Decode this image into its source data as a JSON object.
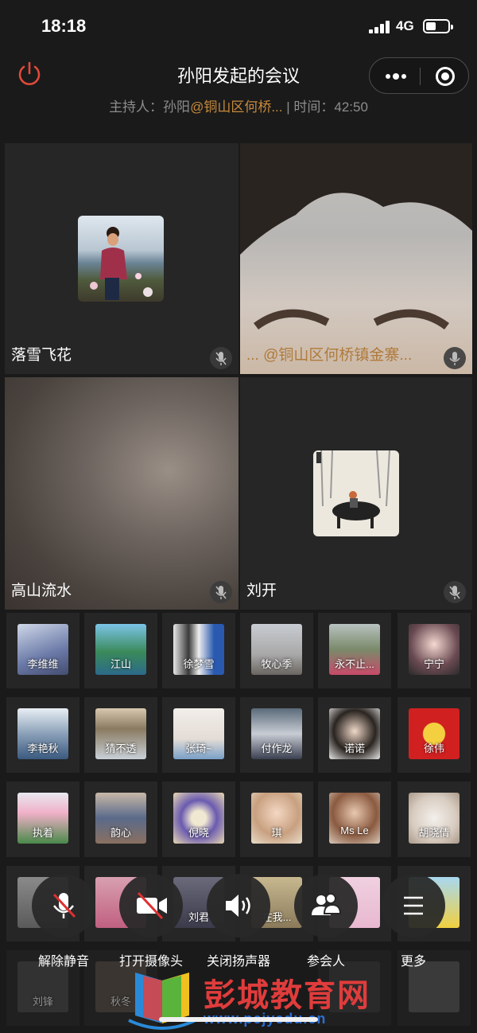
{
  "status": {
    "time": "18:18",
    "network": "4G"
  },
  "header": {
    "title": "孙阳发起的会议",
    "host_label": "主持人：孙阳",
    "host_org": "@铜山区何桥...",
    "time_label": "| 时间：42:50"
  },
  "main_tiles": [
    {
      "name": "落雪飞花"
    },
    {
      "name": "... @铜山区何桥镇金寨..."
    },
    {
      "name": "高山流水"
    },
    {
      "name": "刘开"
    }
  ],
  "participants": [
    [
      "李维维",
      "江山",
      "徐梦雪",
      "牧心季",
      "永不止...",
      "宁宁"
    ],
    [
      "李艳秋",
      "猜不透",
      "张琦~",
      "付作龙",
      "诺诺",
      "徐伟"
    ],
    [
      "执着",
      "韵心",
      "倪晓",
      "琪",
      "Ms Le",
      "胡晓倩"
    ],
    [
      "",
      "",
      "刘君",
      "在我...",
      "",
      ""
    ],
    [
      "刘锋",
      "秋冬",
      "",
      "",
      "",
      ""
    ]
  ],
  "controls": {
    "unmute": "解除静音",
    "camera": "打开摄像头",
    "speaker": "关闭扬声器",
    "participants": "参会人",
    "more": "更多"
  },
  "watermark": {
    "text": "彭城教育网",
    "url": "www.pcjyedu.cn"
  },
  "colors": {
    "accent_red": "#e04a3a",
    "host_orange": "#c88a3c",
    "bg": "#1a1a1a",
    "tile": "#262626"
  }
}
